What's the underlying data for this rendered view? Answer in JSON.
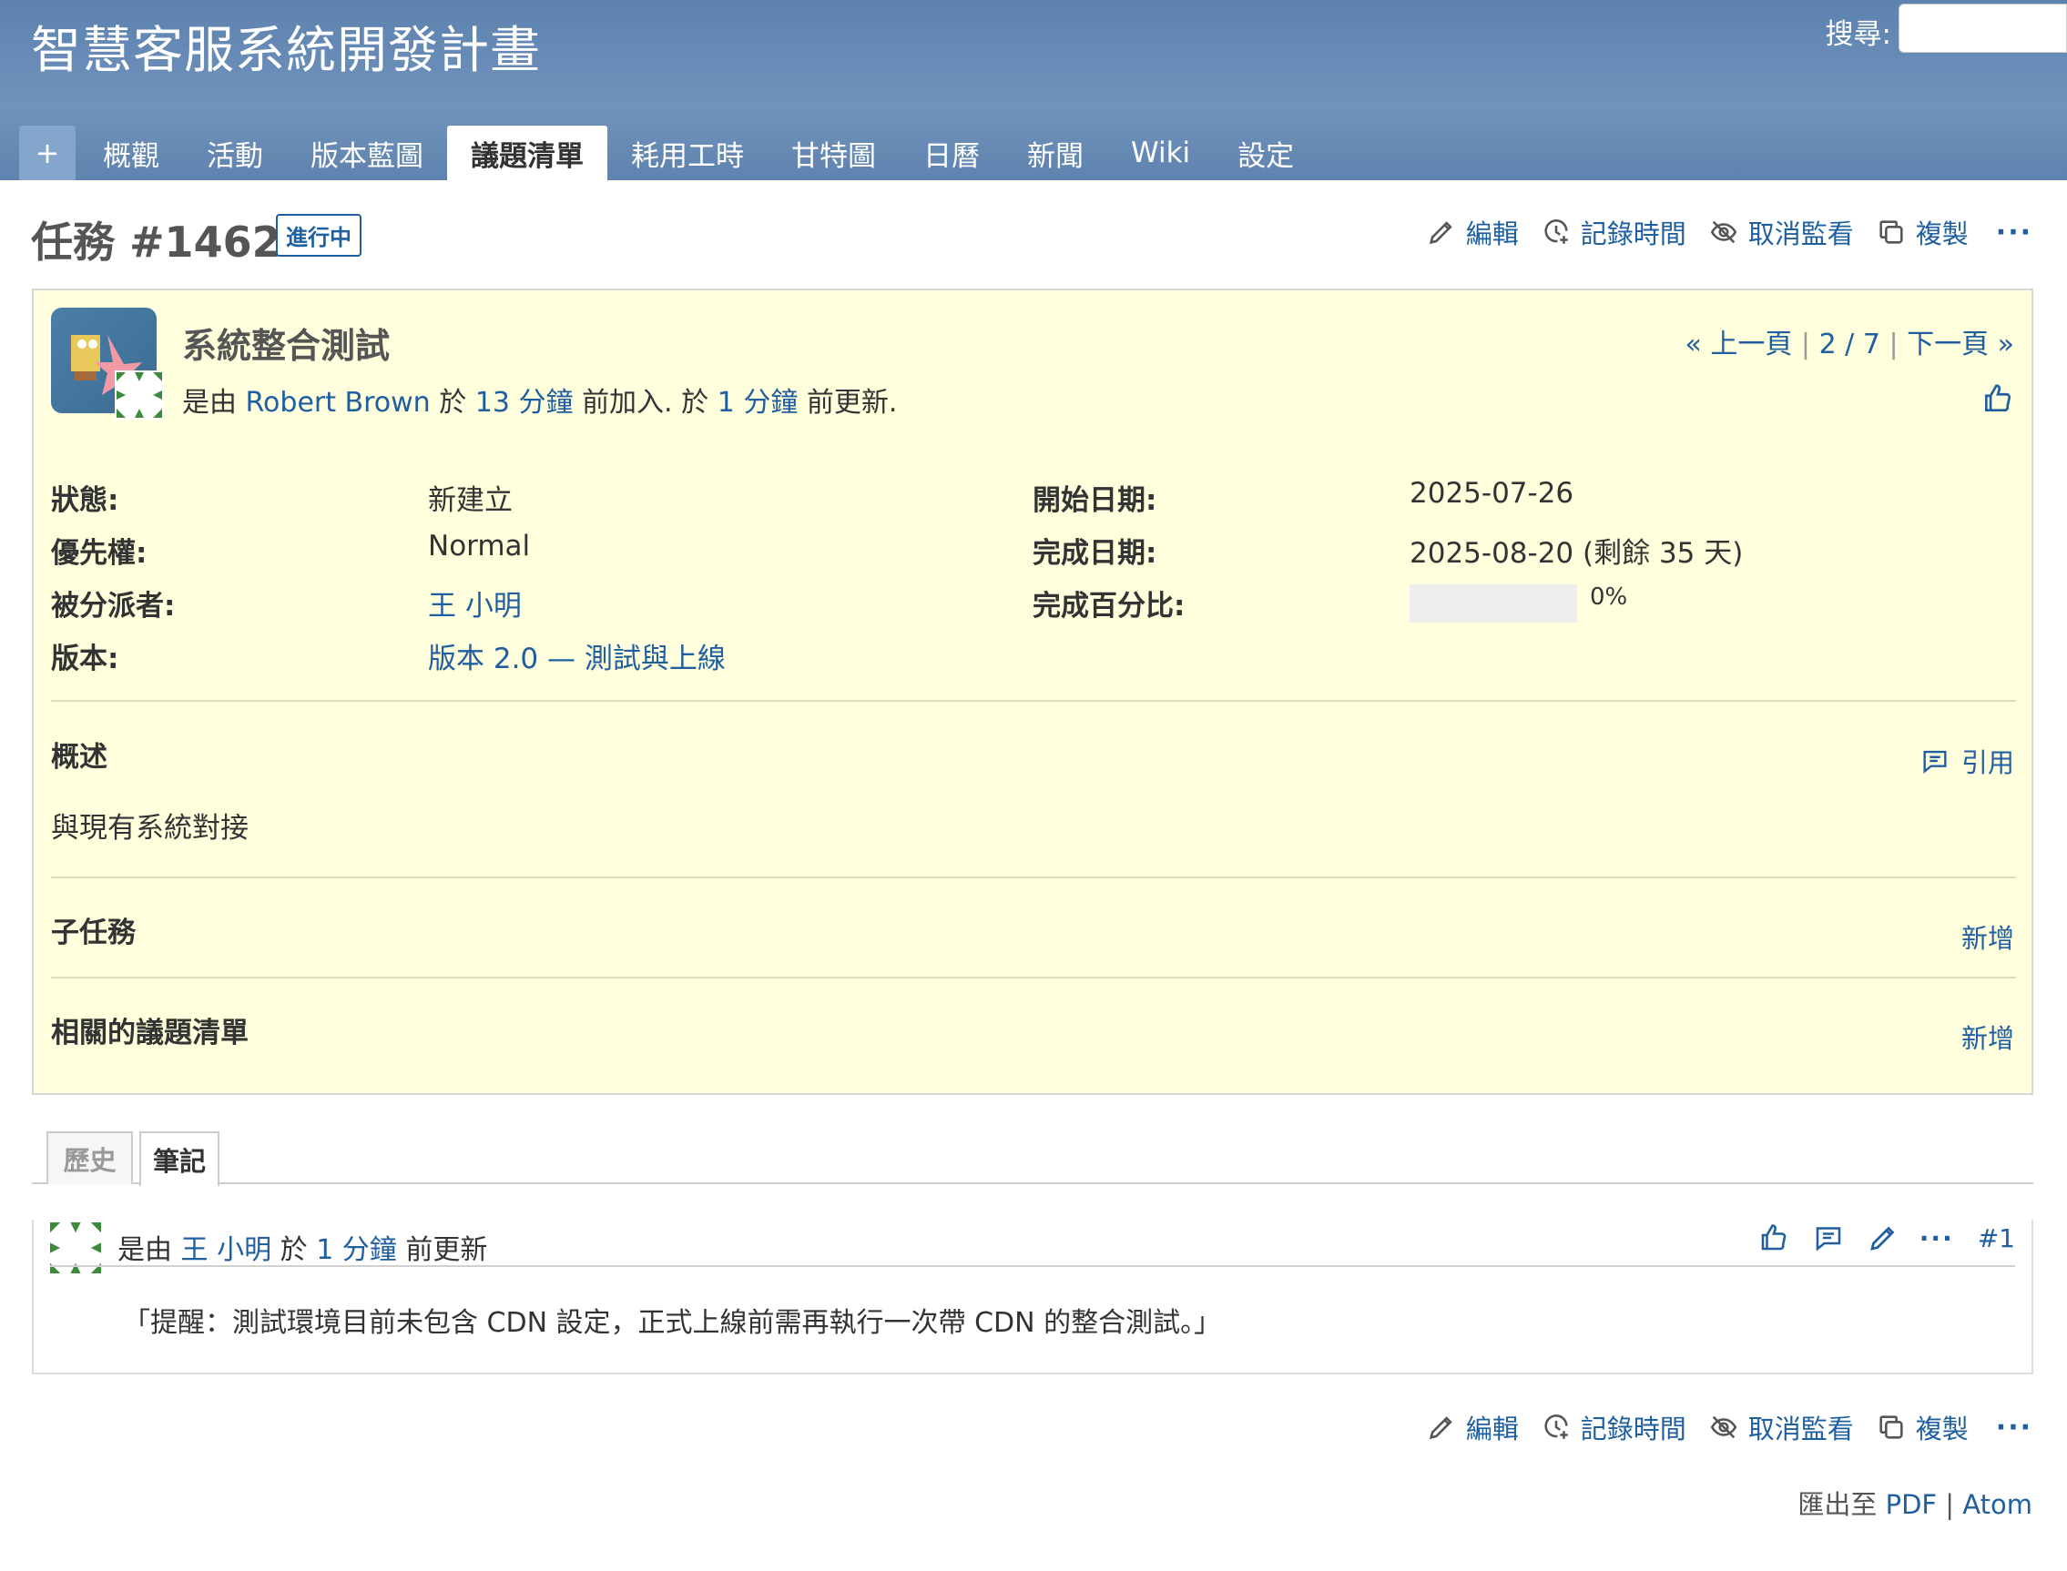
{
  "header": {
    "project_title": "智慧客服系統開發計畫",
    "search_label": "搜尋:",
    "search_placeholder": ""
  },
  "tabs": [
    {
      "label": "+"
    },
    {
      "label": "概觀"
    },
    {
      "label": "活動"
    },
    {
      "label": "版本藍圖"
    },
    {
      "label": "議題清單",
      "selected": true
    },
    {
      "label": "耗用工時"
    },
    {
      "label": "甘特圖"
    },
    {
      "label": "日曆"
    },
    {
      "label": "新聞"
    },
    {
      "label": "Wiki"
    },
    {
      "label": "設定"
    }
  ],
  "issue": {
    "title": "任務 #1462",
    "status_badge": "進行中",
    "subject": "系統整合測試",
    "author_prefix": "是由",
    "author": "Robert Brown",
    "added_prefix": "於",
    "added_ago": "13 分鐘",
    "added_suffix": "前加入.",
    "updated_prefix": "於",
    "updated_ago": "1 分鐘",
    "updated_suffix": "前更新.",
    "pager": {
      "prev": "« 上一頁",
      "position": "2 / 7",
      "next": "下一頁 »"
    },
    "attributes": {
      "status_label": "狀態:",
      "status_value": "新建立",
      "priority_label": "優先權:",
      "priority_value": "Normal",
      "assignee_label": "被分派者:",
      "assignee_value": "王 小明",
      "version_label": "版本:",
      "version_value": "版本 2.0 — 測試與上線",
      "start_label": "開始日期:",
      "start_value": "2025-07-26",
      "due_label": "完成日期:",
      "due_value": "2025-08-20 (剩餘 35 天)",
      "done_label": "完成百分比:",
      "done_value": "0%",
      "done_ratio": 0
    },
    "description_title": "概述",
    "quote_label": "引用",
    "description": "與現有系統對接",
    "subtasks_title": "子任務",
    "subtasks_add": "新增",
    "related_title": "相關的議題清單",
    "related_add": "新增"
  },
  "actions": {
    "edit": "編輯",
    "log_time": "記錄時間",
    "unwatch": "取消監看",
    "copy": "複製",
    "more": "···"
  },
  "history_tabs": [
    {
      "label": "歷史"
    },
    {
      "label": "筆記",
      "selected": true
    }
  ],
  "journal": {
    "prefix": "是由",
    "user": "王 小明",
    "mid": "於",
    "ago": "1 分鐘",
    "suffix": "前更新",
    "number": "#1",
    "more": "···",
    "note": "「提醒：測試環境目前未包含 CDN 設定，正式上線前需再執行一次帶 CDN 的整合測試。」"
  },
  "export": {
    "prefix": "匯出至",
    "pdf": "PDF",
    "separator": "|",
    "atom": "Atom"
  },
  "colors": {
    "header": "#6386b3",
    "link": "#1f5fa0",
    "issue_bg": "#ffffdd"
  }
}
